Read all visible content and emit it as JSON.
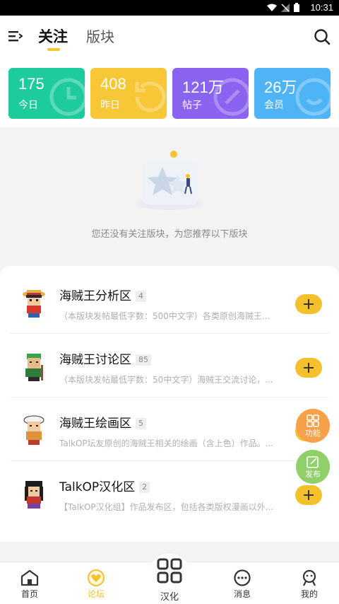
{
  "status_bar": {
    "time": "10:31"
  },
  "header": {
    "tabs": [
      {
        "label": "关注",
        "active": true
      },
      {
        "label": "版块",
        "active": false
      }
    ]
  },
  "stats": [
    {
      "value": "175",
      "label": "今日",
      "color": "#1ecb9c"
    },
    {
      "value": "408",
      "label": "昨日",
      "color": "#f8c737"
    },
    {
      "value": "121万",
      "label": "帖子",
      "color": "#8a63f0"
    },
    {
      "value": "26万",
      "label": "会员",
      "color": "#4fb4f6"
    }
  ],
  "empty_state": {
    "message": "您还没有关注版块，为您推荐以下版块"
  },
  "boards": [
    {
      "name": "海贼王分析区",
      "count": "4",
      "desc": "（本版块发帖最低字数：500中文字）各类原创海贼王..."
    },
    {
      "name": "海贼王讨论区",
      "count": "85",
      "desc": "（本版块发帖最低字数：50中文字）海贼王交流讨论，..."
    },
    {
      "name": "海贼王绘画区",
      "count": "5",
      "desc": "TalkOP坛友原创的海贼王相关的绘画（含上色）作品。..."
    },
    {
      "name": "TalkOP汉化区",
      "count": "2",
      "desc": "【TalkOP汉化组】作品发布区，包括各类版权漫画以外..."
    }
  ],
  "fabs": {
    "function_label": "功能",
    "post_label": "发布"
  },
  "tabbar": {
    "items": [
      {
        "label": "首页"
      },
      {
        "label": "论坛"
      },
      {
        "label": "汉化"
      },
      {
        "label": "消息"
      },
      {
        "label": "我的"
      }
    ],
    "active_color": "#f4c02b"
  }
}
